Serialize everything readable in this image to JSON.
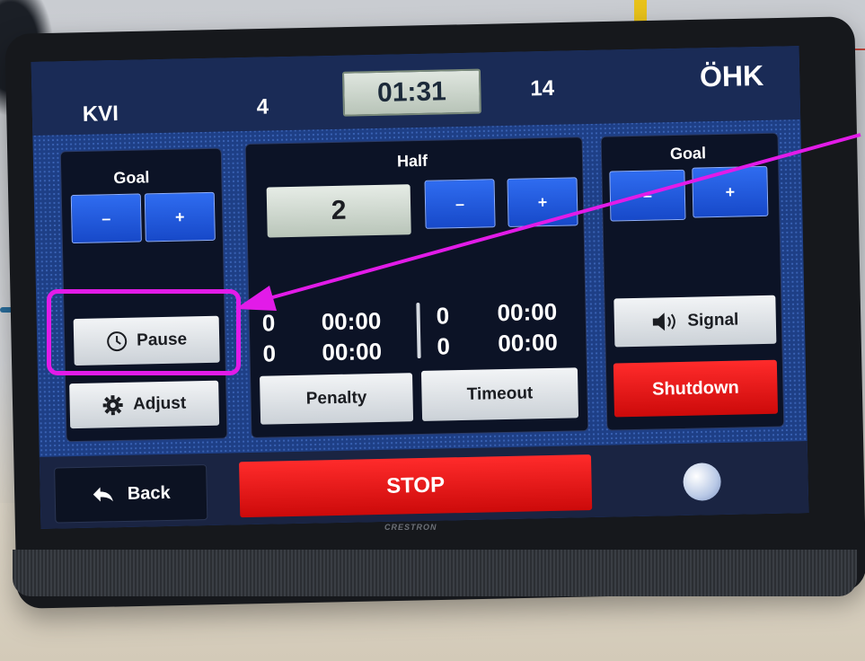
{
  "scoreboard": {
    "home_team": "KVI",
    "home_score": "4",
    "game_clock": "01:31",
    "away_score": "14",
    "away_team": "ÖHK"
  },
  "left_panel": {
    "goal_label": "Goal",
    "minus_label": "–",
    "plus_label": "+",
    "pause_label": "Pause",
    "adjust_label": "Adjust"
  },
  "middle_panel": {
    "half_label": "Half",
    "half_value": "2",
    "minus_label": "–",
    "plus_label": "+",
    "penalty_rows": [
      {
        "num": "0",
        "time": "00:00"
      },
      {
        "num": "0",
        "time": "00:00"
      }
    ],
    "timeout_rows": [
      {
        "num": "0",
        "time": "00:00"
      },
      {
        "num": "0",
        "time": "00:00"
      }
    ],
    "penalty_label": "Penalty",
    "timeout_label": "Timeout"
  },
  "right_panel": {
    "goal_label": "Goal",
    "minus_label": "–",
    "plus_label": "+",
    "signal_label": "Signal",
    "shutdown_label": "Shutdown"
  },
  "bottom_bar": {
    "back_label": "Back",
    "stop_label": "STOP"
  },
  "device_brand": "CRESTRON",
  "colors": {
    "annotation": "#e21be8",
    "stop_red": "#ff2b2b",
    "goal_blue": "#2f6cf0"
  },
  "icons": [
    "clock-icon",
    "gear-icon",
    "speaker-icon",
    "back-arrow-icon",
    "ball-icon"
  ]
}
